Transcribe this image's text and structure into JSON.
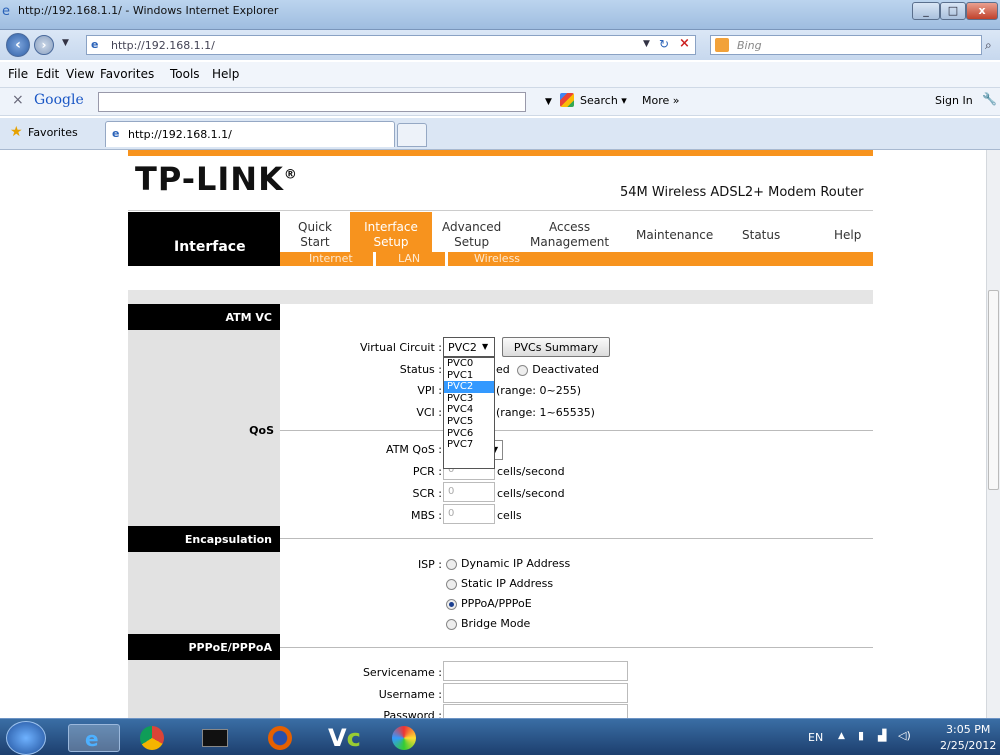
{
  "window": {
    "title": "http://192.168.1.1/ - Windows Internet Explorer"
  },
  "address": {
    "url": "http://192.168.1.1/",
    "search_placeholder": "Bing"
  },
  "menu": [
    "File",
    "Edit",
    "View",
    "Favorites",
    "Tools",
    "Help"
  ],
  "googlebar": {
    "close": "×",
    "logo": "Google",
    "search_label": "Search ▾",
    "more": "More »",
    "sign_in": "Sign In"
  },
  "favorites": {
    "label": "Favorites",
    "tab_title": "http://192.168.1.1/"
  },
  "router": {
    "brand": "TP-LINK",
    "brand_mark": "®",
    "product": "54M Wireless ADSL2+ Modem Router",
    "section_title": "Interface",
    "nav": [
      {
        "l1": "Quick",
        "l2": "Start"
      },
      {
        "l1": "Interface",
        "l2": "Setup"
      },
      {
        "l1": "Advanced",
        "l2": "Setup"
      },
      {
        "l1": "Access",
        "l2": "Management"
      },
      {
        "l1": "Maintenance",
        "l2": ""
      },
      {
        "l1": "Status",
        "l2": ""
      },
      {
        "l1": "Help",
        "l2": ""
      }
    ],
    "subnav": [
      "Internet",
      "LAN",
      "Wireless"
    ],
    "sections": {
      "atm": "ATM VC",
      "qos": "QoS",
      "encap": "Encapsulation",
      "pppoe": "PPPoE/PPPoA"
    },
    "labels": {
      "vc": "Virtual Circuit :",
      "status": "Status :",
      "vpi": "VPI :",
      "vci": "VCI :",
      "atmqos": "ATM QoS :",
      "pcr": "PCR :",
      "scr": "SCR :",
      "mbs": "MBS :",
      "isp": "ISP :",
      "service": "Servicename :",
      "user": "Username :",
      "pass": "Password :"
    },
    "values": {
      "vc_selected": "PVC2",
      "pcr": "0",
      "scr": "0",
      "mbs": "0"
    },
    "status_partial": "ed",
    "status_deactivated": "Deactivated",
    "vpi_range": "(range: 0~255)",
    "vci_range": "(range: 1~65535)",
    "units": {
      "pcr": "cells/second",
      "scr": "cells/second",
      "mbs": "cells"
    },
    "pvcs_button": "PVCs Summary",
    "pvc_options": [
      "PVC0",
      "PVC1",
      "PVC2",
      "PVC3",
      "PVC4",
      "PVC5",
      "PVC6",
      "PVC7"
    ],
    "isp_options": [
      "Dynamic IP Address",
      "Static IP Address",
      "PPPoA/PPPoE",
      "Bridge Mode"
    ],
    "isp_selected": "PPPoA/PPPoE"
  },
  "taskbar": {
    "lang": "EN",
    "time": "3:05 PM",
    "date": "2/25/2012"
  }
}
